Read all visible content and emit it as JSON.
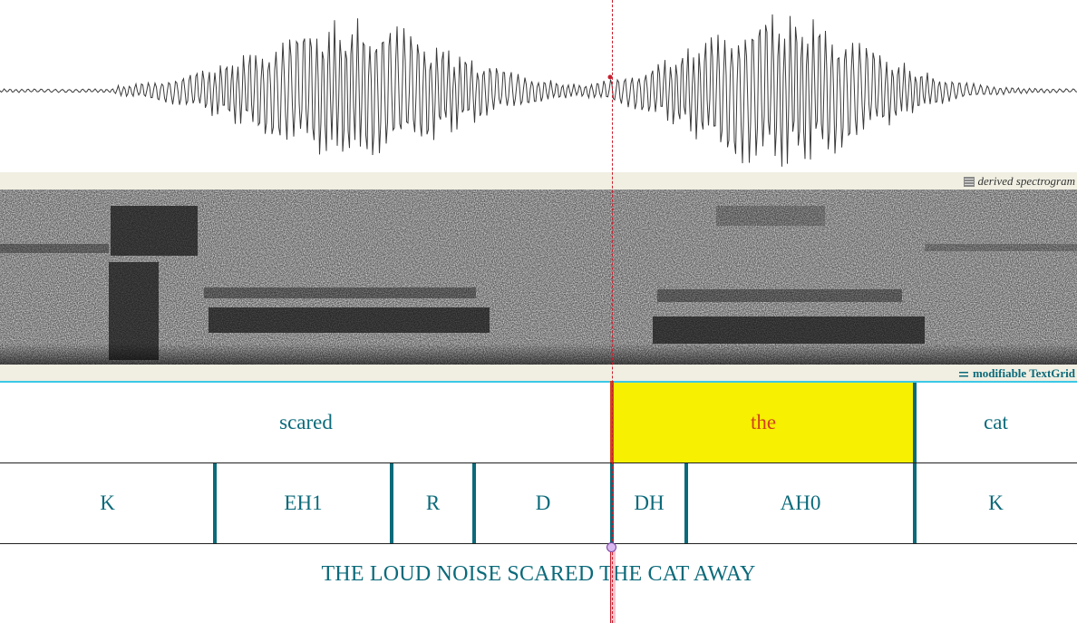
{
  "labels": {
    "spectrogram": "derived spectrogram",
    "textgrid": "modifiable TextGrid"
  },
  "colors": {
    "accent": "#0b6a7a",
    "selection": "#f7f000",
    "selection_text": "#d2431f",
    "cursor": "#c81e2c",
    "tier_top": "#3cc8e6"
  },
  "words": [
    {
      "label": "scared",
      "selected": false
    },
    {
      "label": "the",
      "selected": true
    },
    {
      "label": "cat",
      "selected": false
    }
  ],
  "phones": [
    {
      "label": "K"
    },
    {
      "label": "EH1"
    },
    {
      "label": "R"
    },
    {
      "label": "D"
    },
    {
      "label": "DH"
    },
    {
      "label": "AH0"
    },
    {
      "label": "K"
    }
  ],
  "sentence": "THE LOUD NOISE SCARED THE CAT AWAY",
  "icons": [
    "spectrogram-icon",
    "textgrid-icon"
  ]
}
